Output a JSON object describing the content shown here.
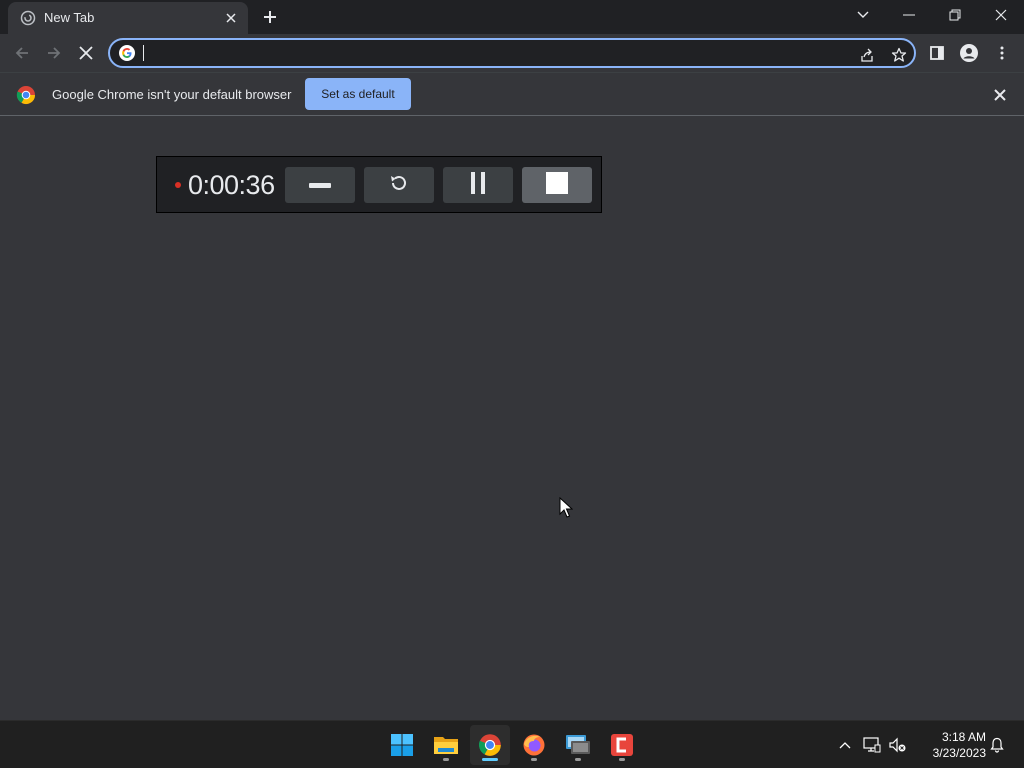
{
  "tab": {
    "title": "New Tab"
  },
  "omnibox": {
    "value": "",
    "placeholder": ""
  },
  "infobar": {
    "message": "Google Chrome isn't your default browser",
    "button_label": "Set as default"
  },
  "recorder": {
    "elapsed": "0:00:36",
    "recording_indicator_color": "#d93025",
    "buttons": [
      "minimize-icon",
      "restart-icon",
      "pause-icon",
      "stop-icon"
    ]
  },
  "taskbar": {
    "apps": [
      "windows-start-icon",
      "file-explorer-icon",
      "chrome-icon",
      "firefox-icon",
      "remote-desktop-icon",
      "screen-recorder-icon"
    ],
    "active_app": "chrome-icon",
    "clock": {
      "time": "3:18 AM",
      "date": "3/23/2023"
    }
  },
  "colors": {
    "accent": "#8ab4f8",
    "titlebar": "#202124",
    "content_bg": "#35363a",
    "taskbar": "#202020"
  }
}
